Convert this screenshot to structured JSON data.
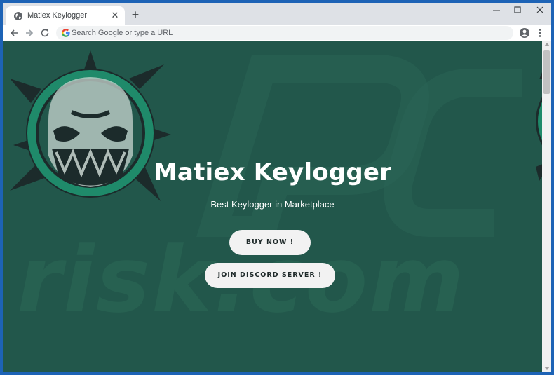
{
  "browser": {
    "tab": {
      "title": "Matiex Keylogger",
      "close_glyph": "✕",
      "favicon": "globe-icon"
    },
    "new_tab_glyph": "+",
    "window_controls": [
      "minimize-icon",
      "maximize-icon",
      "close-icon"
    ],
    "nav": [
      "back-arrow-icon",
      "forward-arrow-icon",
      "reload-icon"
    ],
    "omnibox": {
      "placeholder": "Search Google or type a URL",
      "value": ""
    },
    "profile_icon": "account-circle-icon",
    "menu_icon": "kebab-menu-icon"
  },
  "page": {
    "title": "Matiex Keylogger",
    "subtitle": "Best Keylogger in Marketplace",
    "buttons": {
      "buy": "BUY NOW !",
      "discord": "JOIN DISCORD SERVER !"
    },
    "watermark": "risk.com",
    "logo": "skull-logo-icon"
  },
  "colors": {
    "page_background": "#22574b",
    "button_background": "#f2f2f2",
    "accent_ring": "#1f8a6a",
    "window_frame": "#1d63b6"
  }
}
